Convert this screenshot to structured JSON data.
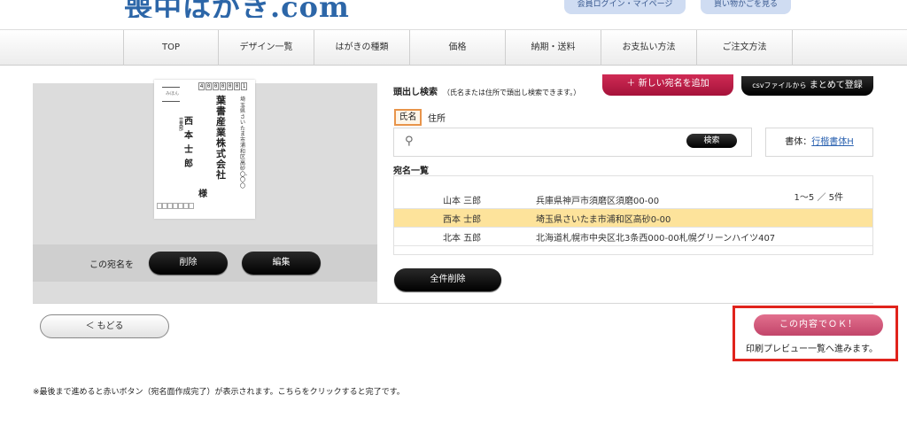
{
  "header": {
    "logo": "喪中はがき.com",
    "login_label": "会員ログイン・マイページ",
    "cart_label": "買い物かごを見る"
  },
  "nav": {
    "items": [
      "TOP",
      "デザイン一覧",
      "はがきの種類",
      "価格",
      "納期・送料",
      "お支払い方法",
      "ご注文方法"
    ]
  },
  "preview": {
    "miha": "みほん",
    "zip": [
      "4",
      "0",
      "0",
      "0",
      "0",
      "0",
      "1"
    ],
    "recipient_address": "埼玉県さいたま市浦和区高砂〇-〇〇",
    "company": "葉書産業株式会社",
    "department": "営業部",
    "name": "西本士郎",
    "honorific": "様",
    "action_label": "この宛名を",
    "delete_label": "削除",
    "edit_label": "編集"
  },
  "search": {
    "title": "頭出し検索",
    "note": "（氏名または住所で頭出し検索できます。）",
    "tab_name": "氏名",
    "tab_address": "住所",
    "input_value": "",
    "button_label": "検索",
    "mag_icon": "search-icon"
  },
  "buttons": {
    "new_address": "＋ 新しい宛名を追加",
    "csv_prefix": "csvファイルから",
    "csv_main": "まとめて登録",
    "delete_all": "全件削除",
    "back": "＜ もどる",
    "ok": "この内容でＯＫ！",
    "ok_caption": "印刷プレビュー一覧へ進みます。"
  },
  "font_setting": {
    "label": "書体：",
    "value": "行楷書体H"
  },
  "address_list": {
    "title": "宛名一覧",
    "count": "1〜5 ／ 5件",
    "rows": [
      {
        "name": "山本 三郎",
        "address": "兵庫県神戸市須磨区須磨00-00",
        "selected": false
      },
      {
        "name": "西本 士郎",
        "address": "埼玉県さいたま市浦和区高砂0-00",
        "selected": true
      },
      {
        "name": "北本 五郎",
        "address": "北海道札幌市中央区北3条西000-00札幌グリーンハイツ407",
        "selected": false
      }
    ]
  },
  "footnote": "※最後まで進めると赤いボタン（宛名面作成完了）が表示されます。こちらをクリックすると完了です。",
  "colors": {
    "accent_red": "#e0231c",
    "ok_pink": "#d05b7c",
    "selected_row": "#fde39b",
    "brand_blue": "#2c66a8"
  }
}
